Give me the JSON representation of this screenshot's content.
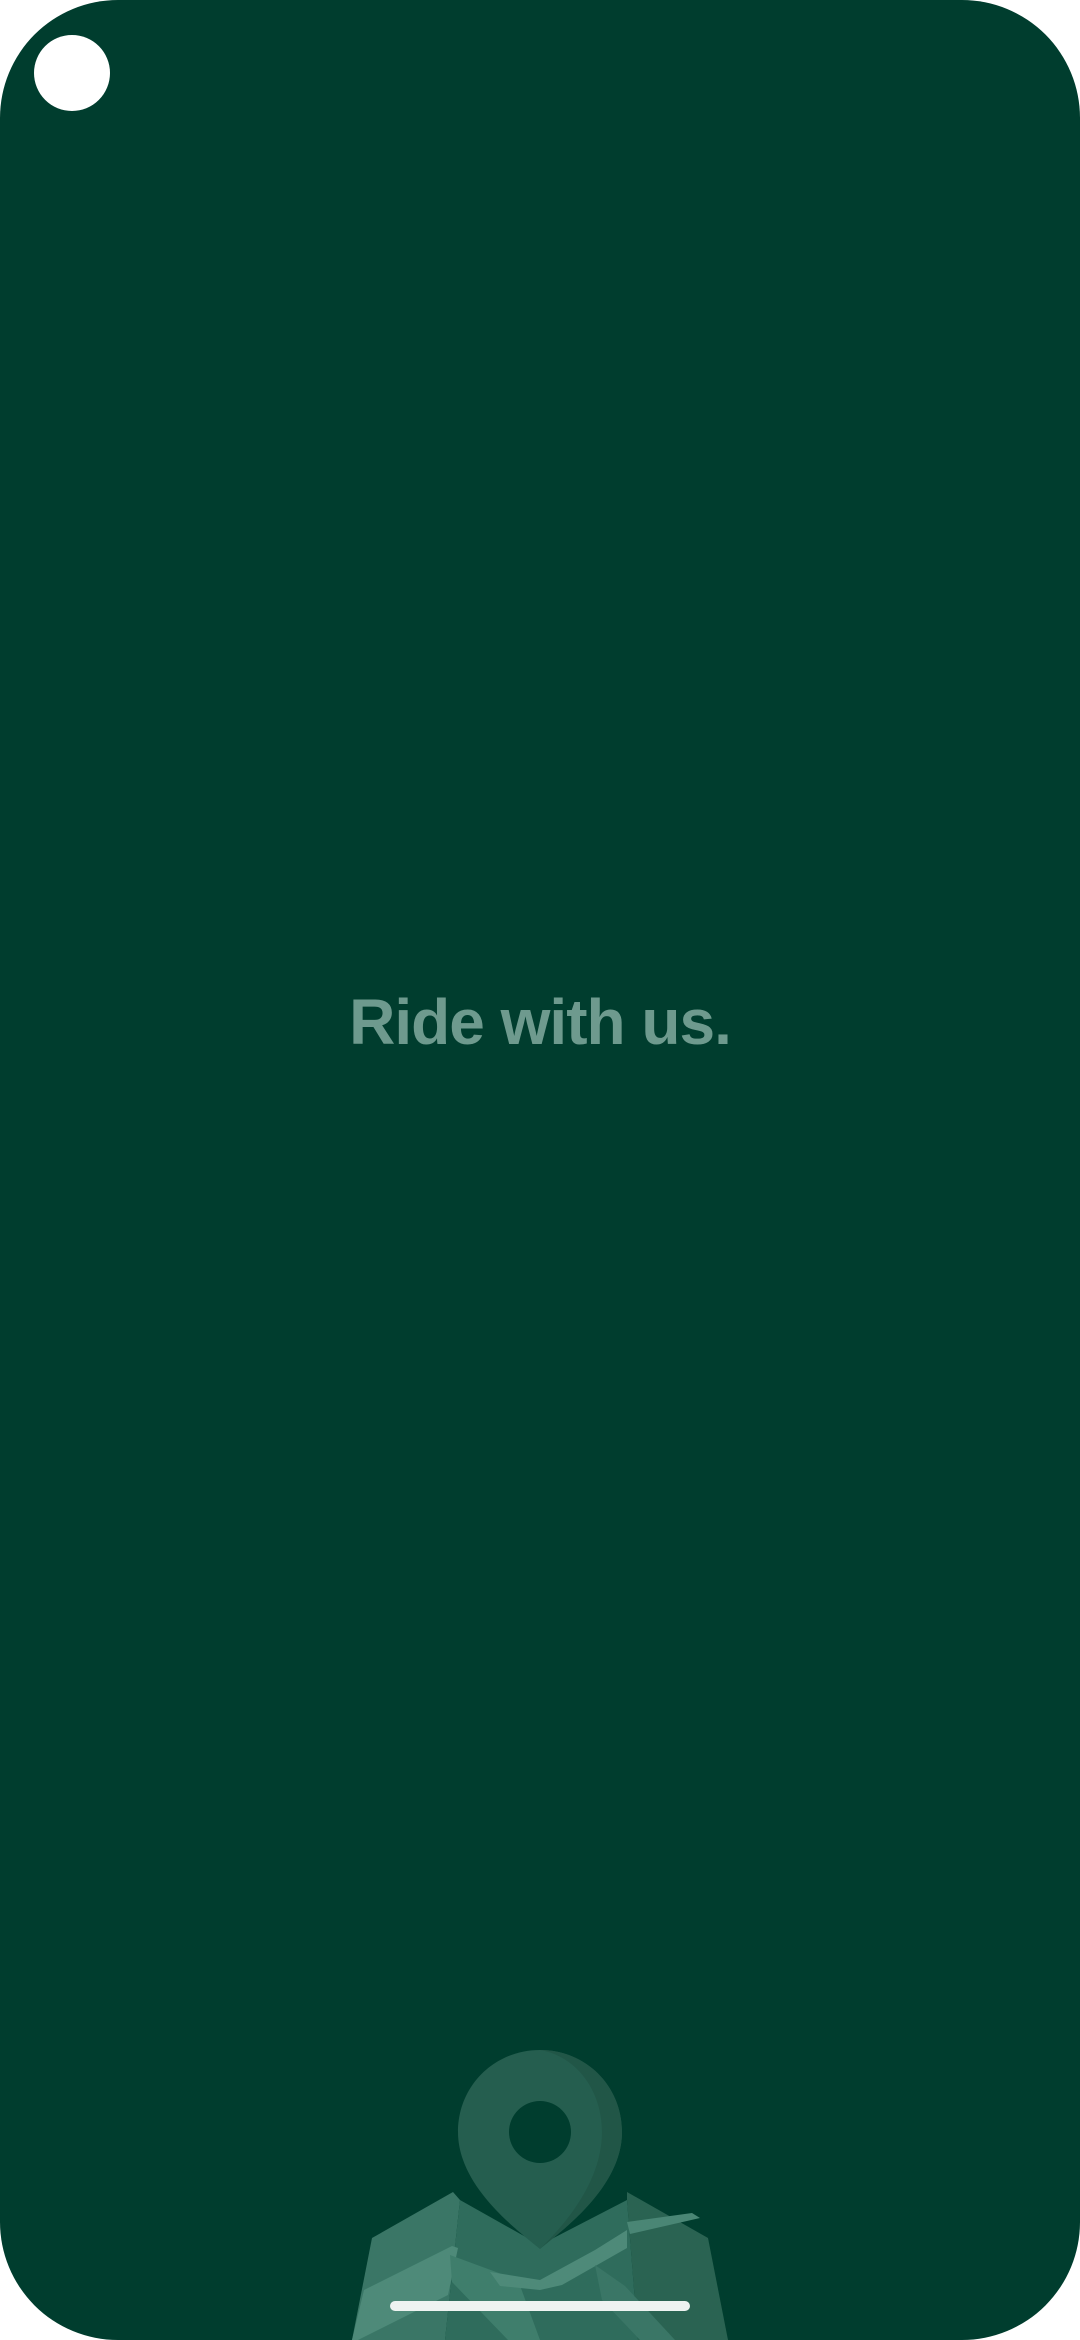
{
  "splash": {
    "tagline": "Ride with us."
  },
  "colors": {
    "background": "#003D2E",
    "tagline": "#6E9A8E",
    "illustration_light": "#4E8A79",
    "illustration_mid": "#3A7666",
    "illustration_dark": "#2A6352",
    "pin_fill": "#255E4F",
    "home_indicator": "#EEF3F1"
  },
  "icons": {
    "camera": "camera-cutout",
    "illustration": "map-pin-icon"
  }
}
